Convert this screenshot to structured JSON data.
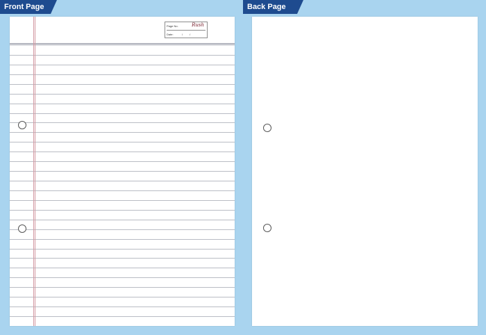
{
  "labels": {
    "front_page": "Front Page",
    "back_page": "Back Page"
  },
  "header_box": {
    "page_no_label": "Page No.",
    "date_label": "Date:",
    "date_separator": "/",
    "brand": "Rush"
  },
  "colors": {
    "background": "#a9d4ef",
    "label_fill": "#1e4b8f",
    "margin_line": "#d39aa3",
    "rule_line": "#b9bcc4"
  },
  "front_page": {
    "ruled_line_count": 28,
    "punch_holes": 2
  },
  "back_page": {
    "punch_holes": 2
  }
}
